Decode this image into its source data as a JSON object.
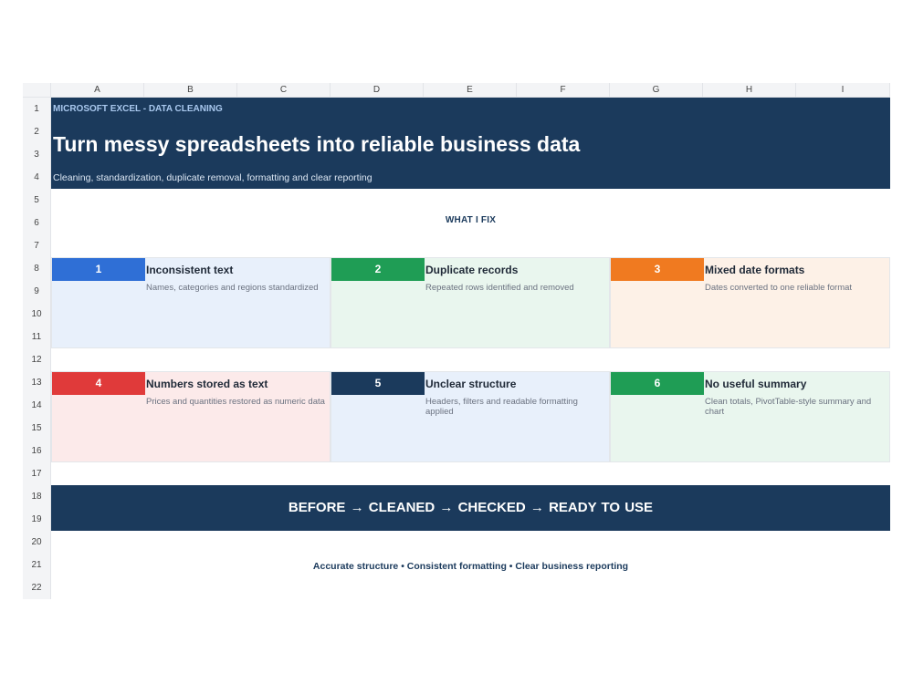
{
  "columns": [
    "A",
    "B",
    "C",
    "D",
    "E",
    "F",
    "G",
    "H",
    "I"
  ],
  "rows": [
    "1",
    "2",
    "3",
    "4",
    "5",
    "6",
    "7",
    "8",
    "9",
    "10",
    "11",
    "12",
    "13",
    "14",
    "15",
    "16",
    "17",
    "18",
    "19",
    "20",
    "21",
    "22"
  ],
  "header": {
    "eyebrow": "MICROSOFT EXCEL - DATA CLEANING",
    "title": "Turn messy spreadsheets into reliable business data",
    "subtitle": "Cleaning, standardization, duplicate removal, formatting and clear reporting"
  },
  "section_title": "WHAT I FIX",
  "cards": [
    {
      "number": "1",
      "title": "Inconsistent text",
      "desc": "Names, categories and regions standardized",
      "accent": "#2f6fd6",
      "bg": "#e8f0fb"
    },
    {
      "number": "2",
      "title": "Duplicate records",
      "desc": "Repeated rows identified and removed",
      "accent": "#1f9d55",
      "bg": "#e9f6ee"
    },
    {
      "number": "3",
      "title": "Mixed date formats",
      "desc": "Dates converted to one reliable format",
      "accent": "#f07a20",
      "bg": "#fdf1e7"
    },
    {
      "number": "4",
      "title": "Numbers stored as text",
      "desc": "Prices and quantities restored as numeric data",
      "accent": "#e03a3a",
      "bg": "#fceaea"
    },
    {
      "number": "5",
      "title": "Unclear structure",
      "desc": "Headers, filters and readable formatting applied",
      "accent": "#1b3a5c",
      "bg": "#e8f0fb"
    },
    {
      "number": "6",
      "title": "No useful summary",
      "desc": "Clean totals, PivotTable-style summary and chart",
      "accent": "#1f9d55",
      "bg": "#e9f6ee"
    }
  ],
  "process": "BEFORE → CLEANED → CHECKED → READY TO USE",
  "tagline": "Accurate structure • Consistent formatting • Clear business reporting",
  "colors": {
    "navy": "#1b3a5c"
  }
}
